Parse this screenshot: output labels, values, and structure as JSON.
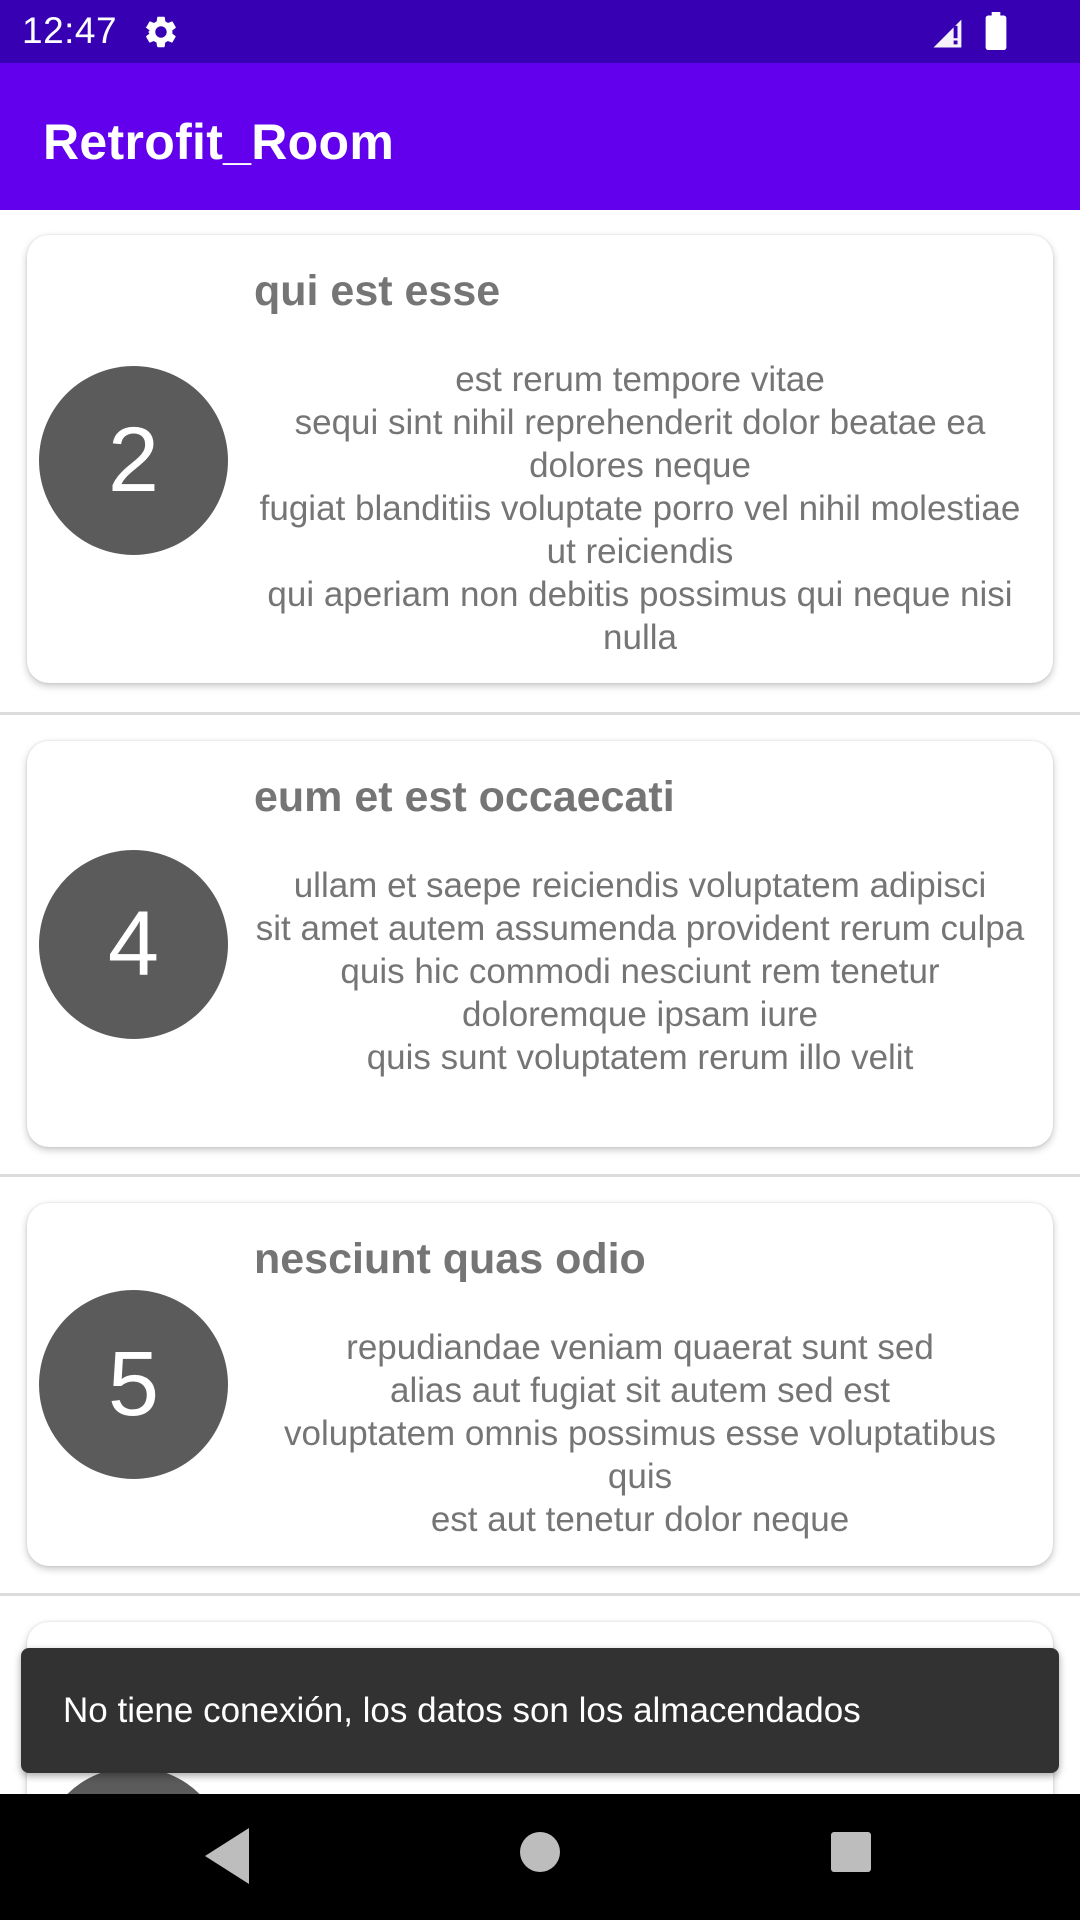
{
  "status_bar": {
    "time": "12:47",
    "icons": [
      "gear-icon",
      "signal-icon",
      "battery-icon"
    ]
  },
  "app_bar": {
    "title": "Retrofit_Room"
  },
  "posts": [
    {
      "id": "2",
      "title": "qui est esse",
      "body": "est rerum tempore vitae\nsequi sint nihil reprehenderit dolor beatae ea dolores neque\nfugiat blanditiis voluptate porro vel nihil molestiae ut reiciendis\nqui aperiam non debitis possimus qui neque nisi nulla"
    },
    {
      "id": "4",
      "title": "eum et est occaecati",
      "body": "ullam et saepe reiciendis voluptatem adipisci\nsit amet autem assumenda provident rerum culpa\nquis hic commodi nesciunt rem tenetur doloremque ipsam iure\nquis sunt voluptatem rerum illo velit"
    },
    {
      "id": "5",
      "title": "nesciunt quas odio",
      "body": "repudiandae veniam quaerat sunt sed\nalias aut fugiat sit autem sed est\nvoluptatem omnis possimus esse voluptatibus quis\nest aut tenetur dolor neque"
    }
  ],
  "snackbar": {
    "message": "No tiene conexión, los datos son los almacendados"
  },
  "nav_bar": {
    "icons": [
      "back-icon",
      "home-icon",
      "recents-icon"
    ]
  },
  "colors": {
    "status_bar": "#3700b3",
    "app_bar": "#6200ee",
    "avatar": "#5c5b5c",
    "text_secondary": "#757575",
    "snackbar": "#323232"
  }
}
